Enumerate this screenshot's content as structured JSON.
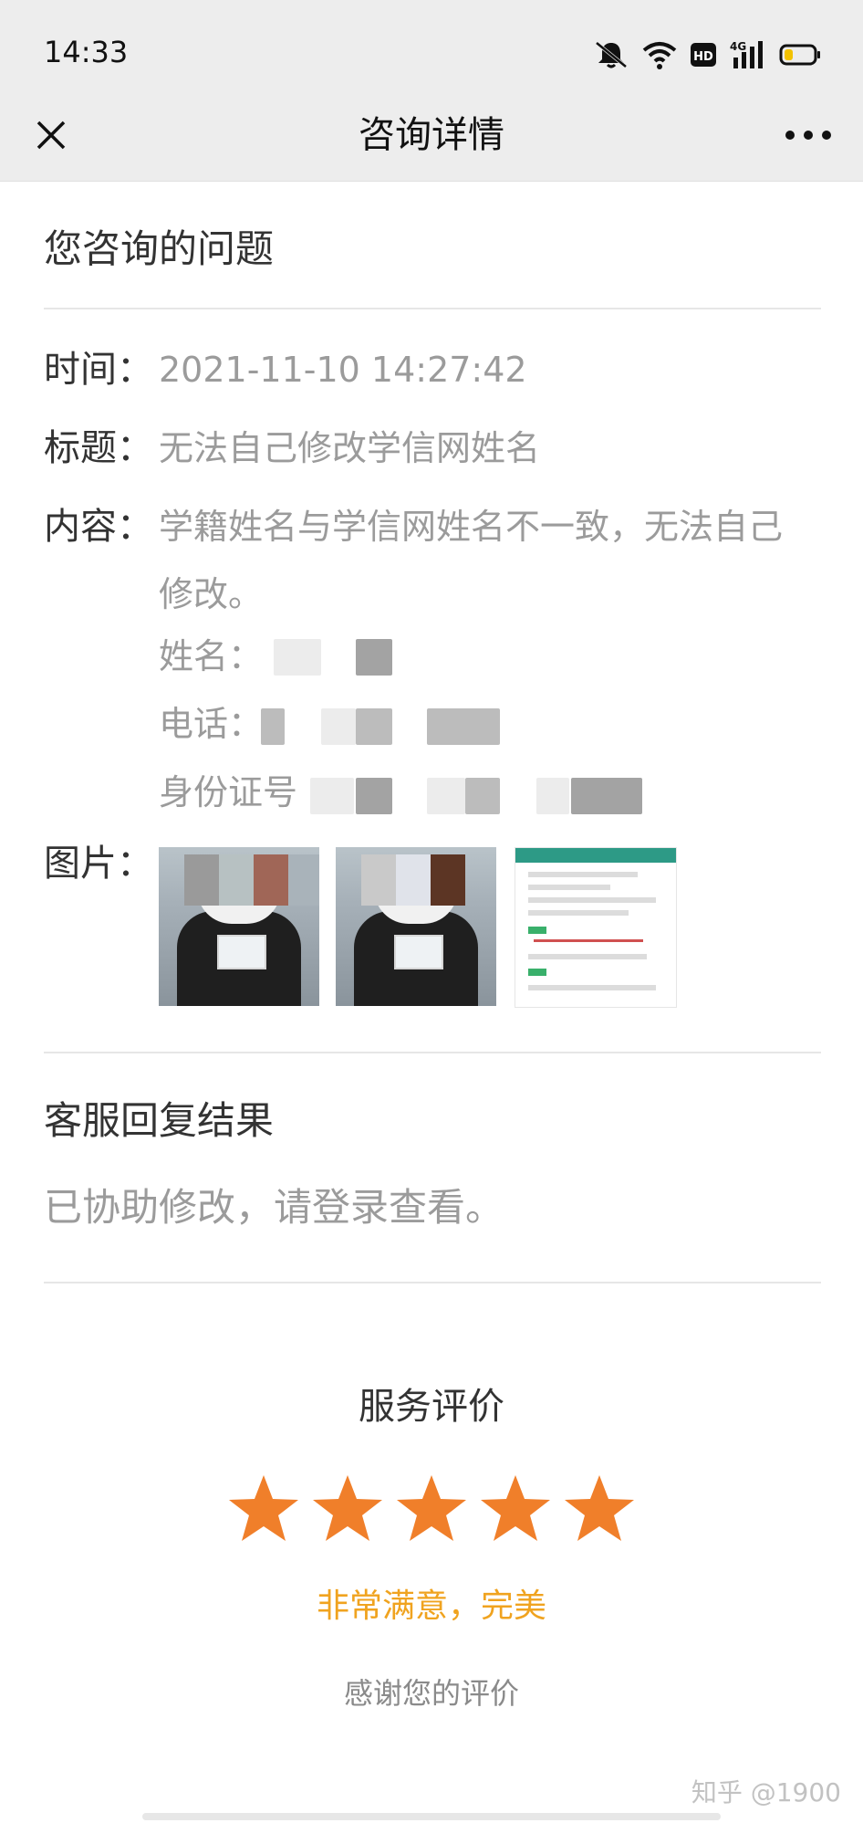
{
  "status_bar": {
    "time": "14:33",
    "icons": [
      "mute-icon",
      "wifi-icon",
      "hd-icon",
      "signal-4g-icon",
      "battery-icon"
    ],
    "hd_label": "HD",
    "network_label": "4G"
  },
  "nav": {
    "title": "咨询详情",
    "close_icon": "close-icon",
    "more_icon": "more-icon"
  },
  "question": {
    "section_title": "您咨询的问题",
    "time_label": "时间：",
    "time_value": "2021-11-10 14:27:42",
    "title_label": "标题：",
    "title_value": "无法自己修改学信网姓名",
    "content_label": "内容：",
    "content_value": "学籍姓名与学信网姓名不一致，无法自己修改。",
    "content_lines": {
      "name_label": "姓名：",
      "phone_label": "电话：",
      "id_label": "身份证号"
    },
    "images_label": "图片："
  },
  "reply": {
    "section_title": "客服回复结果",
    "text": "已协助修改，请登录查看。"
  },
  "rating": {
    "title": "服务评价",
    "stars": 5,
    "max_stars": 5,
    "description": "非常满意，完美",
    "thanks": "感谢您的评价"
  },
  "watermark": "知乎 @1900",
  "colors": {
    "star": "#f07f2a",
    "rating_desc": "#f0a31f",
    "muted_text": "#9b9b9b",
    "header_bg": "#ededed"
  }
}
